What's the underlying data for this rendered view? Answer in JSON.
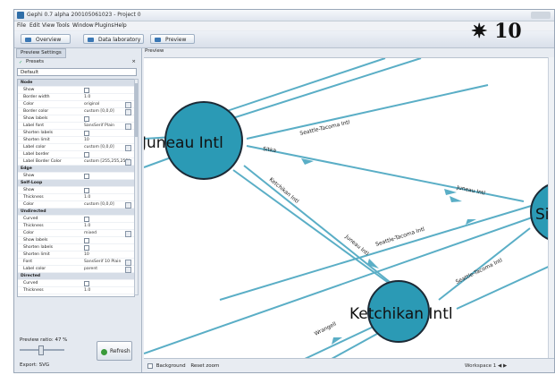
{
  "window": {
    "title": "Gephi 0.7 alpha 200105061023 - Project 0"
  },
  "menu": [
    "File",
    "Edit",
    "View",
    "Tools",
    "Window",
    "Plugins",
    "Help"
  ],
  "toolbar": {
    "overview": "Overview",
    "data_lab": "Data laboratory",
    "preview": "Preview"
  },
  "logo_text": "✷ 10",
  "left_panel": {
    "tab": "Preview Settings",
    "presets_label": "Presets",
    "preset_selected": "Default",
    "properties": [
      {
        "name": "Node",
        "category": true
      },
      {
        "name": "Show",
        "type": "check"
      },
      {
        "name": "Border width",
        "value": "1.0"
      },
      {
        "name": "Color",
        "value": "original",
        "edit": true
      },
      {
        "name": "Border color",
        "value": "custom [0,0,0]",
        "edit": true
      },
      {
        "name": "Show labels",
        "type": "check"
      },
      {
        "name": "Label font",
        "value": "SansSerif Plain",
        "edit": true
      },
      {
        "name": "Shorten labels",
        "type": "check"
      },
      {
        "name": "Shorten limit",
        "value": "10"
      },
      {
        "name": "Label color",
        "value": "custom [0,0,0]",
        "edit": true
      },
      {
        "name": "Label border",
        "type": "check"
      },
      {
        "name": "Label Border Color",
        "value": "custom [255,255,255]",
        "edit": true
      },
      {
        "name": "Edge",
        "category": true
      },
      {
        "name": "Show",
        "type": "check"
      },
      {
        "name": "Self-Loop",
        "category": true
      },
      {
        "name": "Show",
        "type": "check"
      },
      {
        "name": "Thickness",
        "value": "1.0"
      },
      {
        "name": "Color",
        "value": "custom [0,0,0]",
        "edit": true
      },
      {
        "name": "Undirected",
        "category": true
      },
      {
        "name": "Curved",
        "type": "check"
      },
      {
        "name": "Thickness",
        "value": "1.0"
      },
      {
        "name": "Color",
        "value": "mixed",
        "edit": true
      },
      {
        "name": "Show labels",
        "type": "check"
      },
      {
        "name": "Shorten labels",
        "type": "check"
      },
      {
        "name": "Shorten limit",
        "value": "10"
      },
      {
        "name": "Font",
        "value": "SansSerif 10 Plain",
        "edit": true
      },
      {
        "name": "Label color",
        "value": "parent",
        "edit": true
      },
      {
        "name": "Directed",
        "category": true
      },
      {
        "name": "Curved",
        "type": "check"
      },
      {
        "name": "Thickness",
        "value": "1.0"
      }
    ],
    "ratio_label": "Preview ratio: 47 %",
    "refresh": "Refresh",
    "export": "Export:  SVG"
  },
  "preview_tab": "Preview",
  "graph": {
    "nodes": [
      {
        "id": "juneau",
        "label": "Juneau Intl"
      },
      {
        "id": "ketchikan",
        "label": "Ketchikan Intl"
      },
      {
        "id": "sitka",
        "label": "Sitka"
      }
    ],
    "edge_labels": [
      "Seattle-Tacoma Intl",
      "Sitka",
      "Juneau Intl",
      "Ketchikan Intl",
      "Juneau Intl",
      "Seattle-Tacoma Intl",
      "Wrangell",
      "Seattle-Tacoma Intl"
    ]
  },
  "bottom": {
    "background": "Background",
    "reset_zoom": "Reset zoom"
  },
  "status": "Workspace 1  ◀  ▶"
}
